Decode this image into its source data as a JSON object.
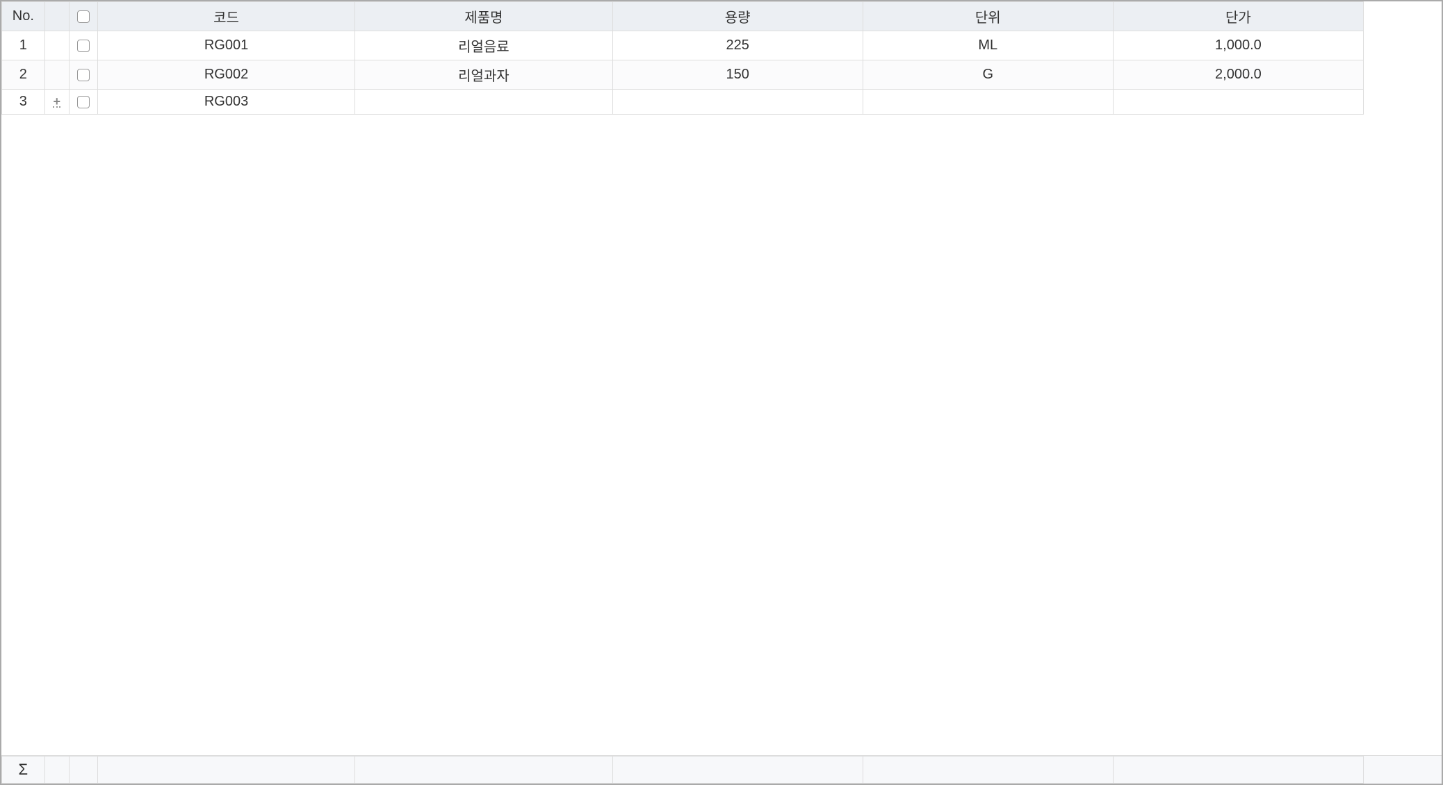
{
  "grid": {
    "headers": {
      "no": "No.",
      "code": "코드",
      "name": "제품명",
      "volume": "용량",
      "unit": "단위",
      "price": "단가"
    },
    "rows": [
      {
        "no": "1",
        "status": "",
        "code": "RG001",
        "name": "리얼음료",
        "volume": "225",
        "unit": "ML",
        "price": "1,000.0"
      },
      {
        "no": "2",
        "status": "",
        "code": "RG002",
        "name": "리얼과자",
        "volume": "150",
        "unit": "G",
        "price": "2,000.0"
      },
      {
        "no": "3",
        "status": "modified",
        "code": "RG003",
        "name": "",
        "volume": "",
        "unit": "",
        "price": ""
      }
    ],
    "footer": {
      "sigma": "Σ",
      "code": "",
      "name": "",
      "volume": "",
      "unit": "",
      "price": ""
    }
  }
}
